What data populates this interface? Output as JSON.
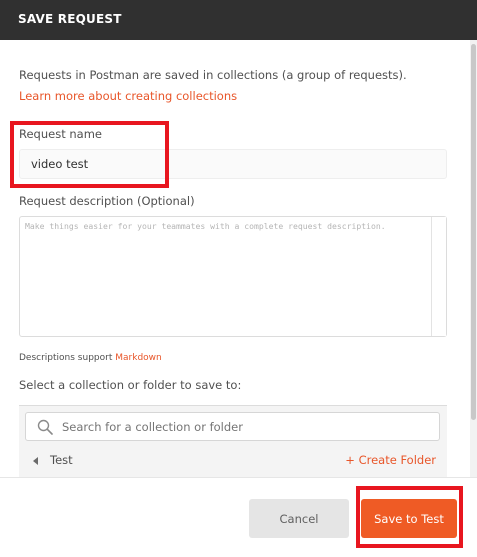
{
  "dialog": {
    "title": "SAVE REQUEST",
    "intro": "Requests in Postman are saved in collections (a group of requests).",
    "learn_link": "Learn more about creating collections"
  },
  "request_name": {
    "label": "Request name",
    "value": "video test"
  },
  "description": {
    "label": "Request description (Optional)",
    "placeholder": "Make things easier for your teammates with a complete request description.",
    "support_text": "Descriptions support",
    "support_link": "Markdown"
  },
  "collection_picker": {
    "label": "Select a collection or folder to save to:",
    "search_placeholder": "Search for a collection or folder",
    "items": [
      {
        "name": "Test",
        "action": "+ Create Folder"
      }
    ]
  },
  "footer": {
    "cancel_label": "Cancel",
    "save_label": "Save to Test"
  },
  "colors": {
    "accent": "#ef5b25",
    "titlebar": "#303030",
    "highlight": "#e8161f"
  }
}
